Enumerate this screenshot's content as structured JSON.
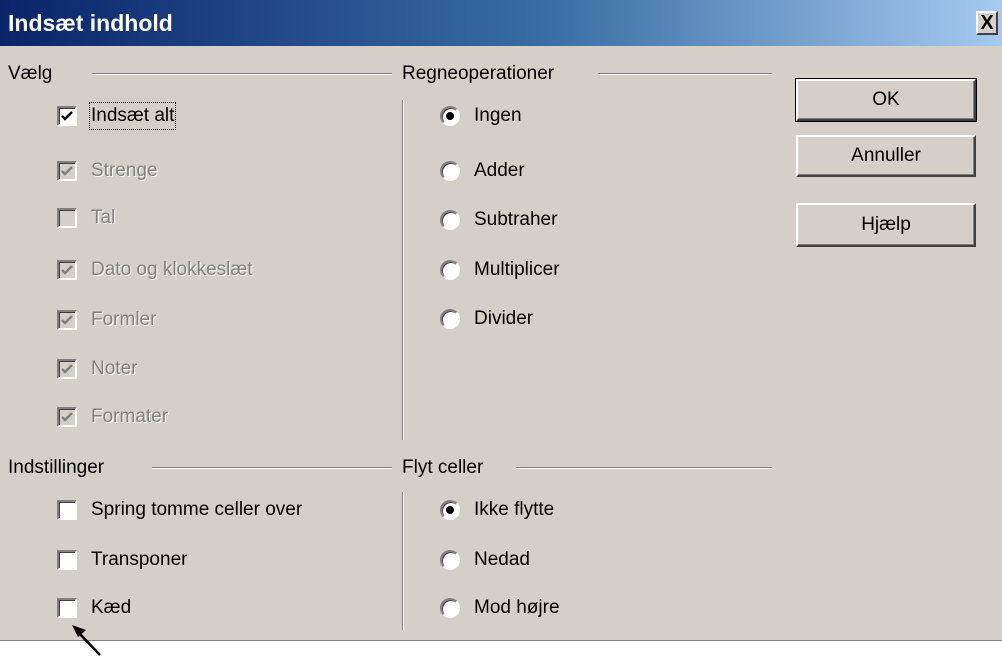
{
  "window": {
    "title": "Indsæt indhold",
    "close_glyph": "X"
  },
  "groups": {
    "select": {
      "title": "Vælg",
      "items": [
        {
          "label": "Indsæt alt",
          "checked": true,
          "enabled": true
        },
        {
          "label": "Strenge",
          "checked": true,
          "enabled": false
        },
        {
          "label": "Tal",
          "checked": false,
          "enabled": false
        },
        {
          "label": "Dato og klokkeslæt",
          "checked": true,
          "enabled": false
        },
        {
          "label": "Formler",
          "checked": true,
          "enabled": false
        },
        {
          "label": "Noter",
          "checked": true,
          "enabled": false
        },
        {
          "label": "Formater",
          "checked": true,
          "enabled": false
        }
      ]
    },
    "operations": {
      "title": "Regneoperationer",
      "items": [
        {
          "label": "Ingen",
          "selected": true
        },
        {
          "label": "Adder",
          "selected": false
        },
        {
          "label": "Subtraher",
          "selected": false
        },
        {
          "label": "Multiplicer",
          "selected": false
        },
        {
          "label": "Divider",
          "selected": false
        }
      ]
    },
    "options": {
      "title": "Indstillinger",
      "items": [
        {
          "label": "Spring tomme celler over",
          "checked": false
        },
        {
          "label": "Transponer",
          "checked": false
        },
        {
          "label": "Kæd",
          "checked": false
        }
      ]
    },
    "move_cells": {
      "title": "Flyt celler",
      "items": [
        {
          "label": "Ikke flytte",
          "selected": true
        },
        {
          "label": "Nedad",
          "selected": false
        },
        {
          "label": "Mod højre",
          "selected": false
        }
      ]
    }
  },
  "buttons": {
    "ok": "OK",
    "cancel": "Annuller",
    "help": "Hjælp"
  },
  "annotation": {
    "icon": "arrow-pointer-icon"
  }
}
